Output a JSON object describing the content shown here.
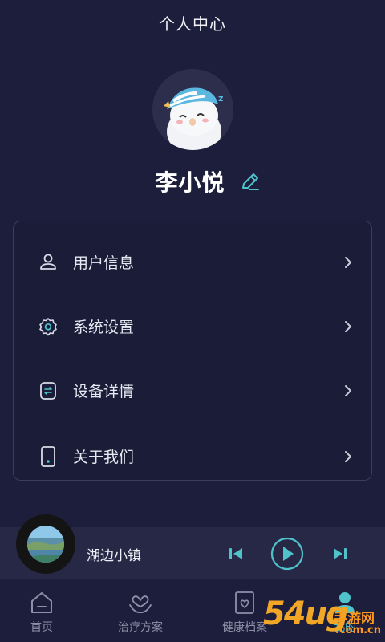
{
  "header": {
    "title": "个人中心"
  },
  "profile": {
    "name": "李小悦",
    "avatar_icon": "sleeping-snowman-avatar",
    "edit_icon": "pencil-icon"
  },
  "menu": {
    "items": [
      {
        "label": "用户信息",
        "icon": "user-icon"
      },
      {
        "label": "系统设置",
        "icon": "gear-icon"
      },
      {
        "label": "设备详情",
        "icon": "device-icon"
      },
      {
        "label": "关于我们",
        "icon": "phone-icon"
      }
    ]
  },
  "player": {
    "song": "湖边小镇",
    "controls": [
      "previous-icon",
      "play-icon",
      "next-icon"
    ]
  },
  "tabs": [
    {
      "label": "首页",
      "icon": "home-icon"
    },
    {
      "label": "治疗方案",
      "icon": "care-icon"
    },
    {
      "label": "健康档案",
      "icon": "health-record-icon"
    },
    {
      "label": "我的",
      "icon": "profile-icon",
      "active": true
    }
  ],
  "watermark": {
    "number": "54ug",
    "text": "手游网",
    "domain": ".com.cn"
  },
  "colors": {
    "background": "#1d1e3b",
    "accent": "#4fc3c9",
    "card_border": "#3a3d5c",
    "player_bg": "#262846"
  }
}
